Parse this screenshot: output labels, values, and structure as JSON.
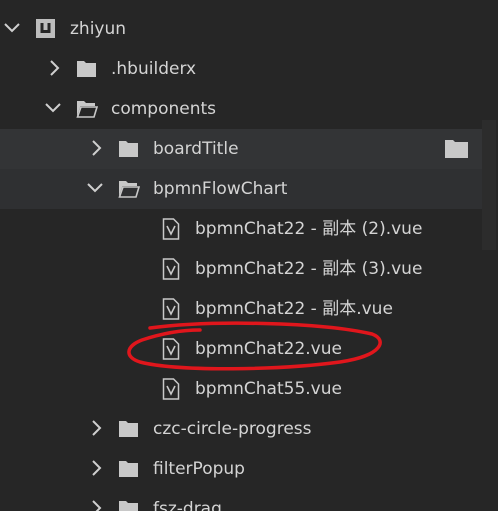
{
  "tree": {
    "project": {
      "label": "zhiyun",
      "icon": "project-icon",
      "expanded": true
    },
    "hbuilderx": {
      "label": ".hbuilderx",
      "icon": "folder-icon",
      "expanded": false
    },
    "components": {
      "label": "components",
      "icon": "folder-open-icon",
      "expanded": true
    },
    "boardTitle": {
      "label": "boardTitle",
      "icon": "folder-icon",
      "expanded": false,
      "side_icon": "folder-icon"
    },
    "bpmnFlowChart": {
      "label": "bpmnFlowChart",
      "icon": "folder-open-icon",
      "expanded": true
    },
    "files": [
      {
        "label": "bpmnChat22 - 副本 (2).vue",
        "icon": "vue-file-icon"
      },
      {
        "label": "bpmnChat22 - 副本 (3).vue",
        "icon": "vue-file-icon"
      },
      {
        "label": "bpmnChat22 - 副本.vue",
        "icon": "vue-file-icon"
      },
      {
        "label": "bpmnChat22.vue",
        "icon": "vue-file-icon",
        "circled": true
      },
      {
        "label": "bpmnChat55.vue",
        "icon": "vue-file-icon"
      }
    ],
    "more_folders": [
      {
        "label": "czc-circle-progress",
        "icon": "folder-icon",
        "expanded": false
      },
      {
        "label": "filterPopup",
        "icon": "folder-icon",
        "expanded": false
      },
      {
        "label": "fsz-drag",
        "icon": "folder-icon",
        "expanded": false
      }
    ]
  },
  "colors": {
    "background": "#262626",
    "hover_row": "#333436",
    "text": "#d4d4d4",
    "icon": "#c8c8c8",
    "annotation": "#e0161c"
  }
}
